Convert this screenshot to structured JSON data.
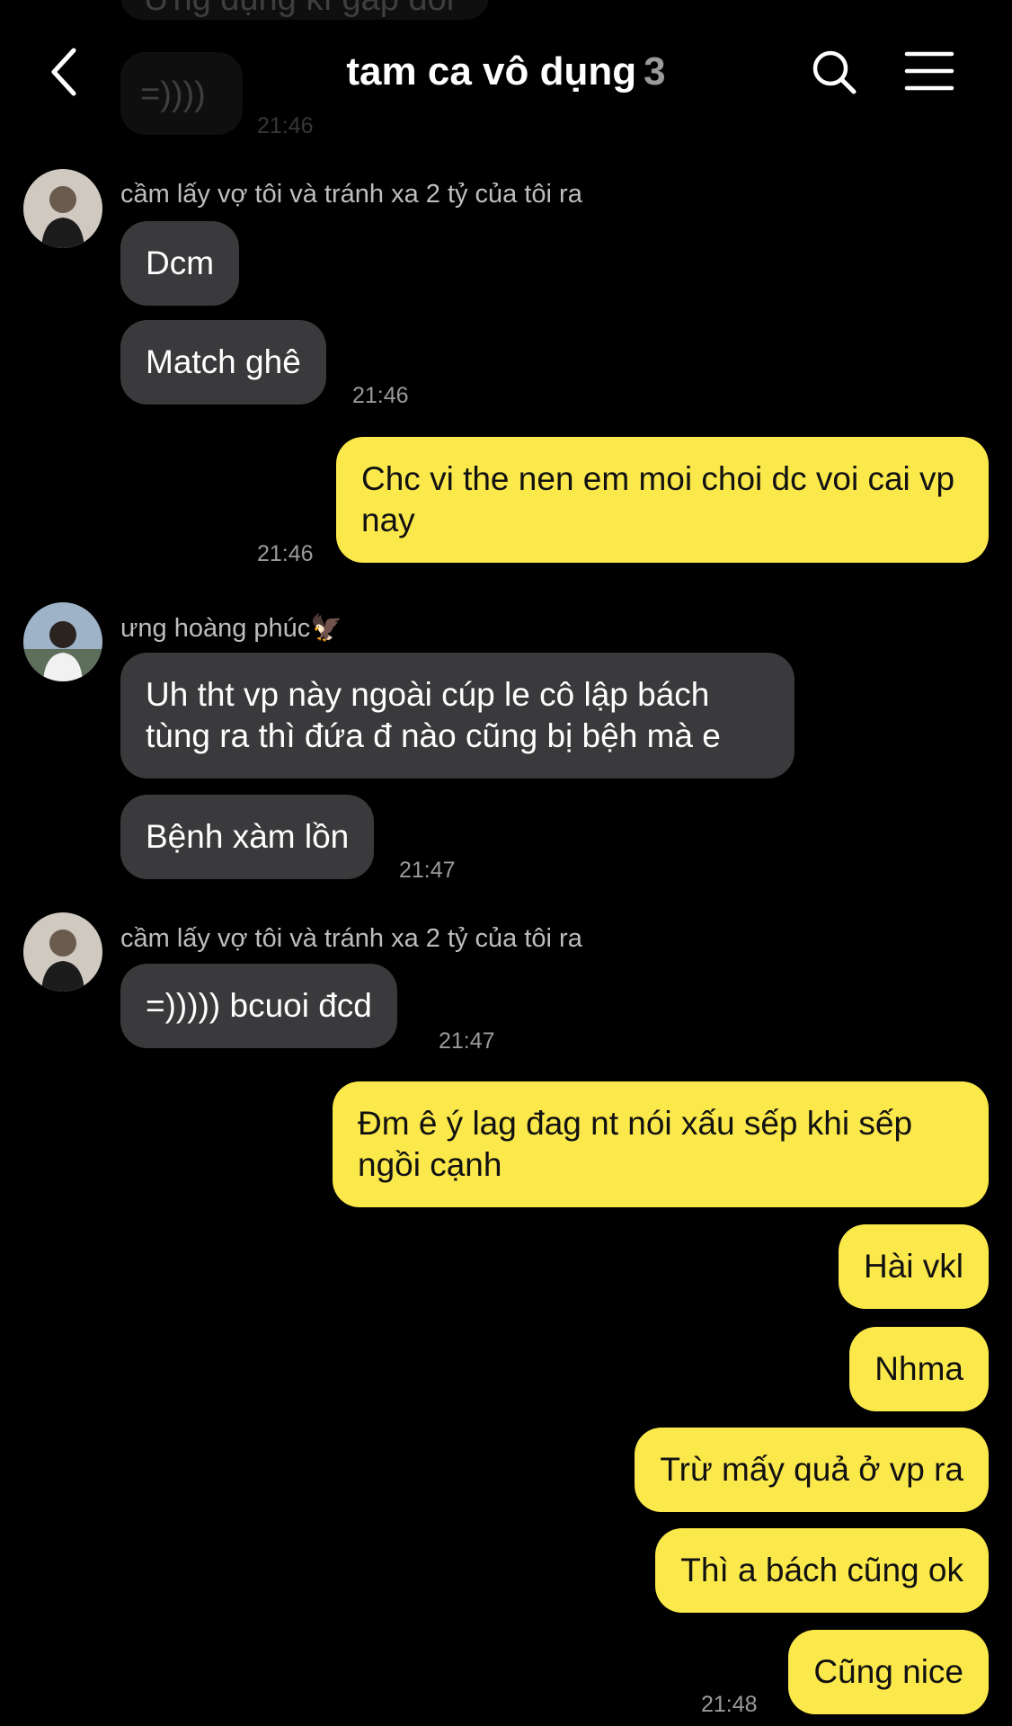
{
  "header": {
    "title": "tam ca vô dụng",
    "member_count": "3",
    "back_icon": "chevron-left-icon",
    "search_icon": "search-icon",
    "menu_icon": "hamburger-menu-icon"
  },
  "faded_top": {
    "partial_text": "Ứng dụng kí gấp đôi",
    "bubble_text": "=))))",
    "time": "21:46"
  },
  "messages": [
    {
      "sender": "cầm lấy vợ tôi và tránh xa 2 tỷ của tôi ra",
      "text": "Dcm"
    },
    {
      "text": "Match ghê",
      "time": "21:46"
    },
    {
      "text": "Chc vi the nen em moi choi dc voi cai vp nay",
      "time": "21:46"
    },
    {
      "sender": "ưng hoàng phúc🦅",
      "text": "Uh tht vp này ngoài cúp le cô lập bách tùng ra thì đứa đ nào cũng bị bệh mà e"
    },
    {
      "text": "Bệnh xàm lồn",
      "time": "21:47"
    },
    {
      "sender": "cầm lấy vợ tôi và tránh xa 2 tỷ của tôi ra",
      "text": "=))))) bcuoi đcd",
      "time": "21:47"
    },
    {
      "text": "Đm ê ý lag đag nt nói xấu sếp khi sếp ngồi cạnh"
    },
    {
      "text": "Hài vkl"
    },
    {
      "text": "Nhma"
    },
    {
      "text": "Trừ mấy quả ở vp ra"
    },
    {
      "text": "Thì a bách cũng ok"
    },
    {
      "text": "Cũng nice",
      "time": "21:48"
    }
  ],
  "colors": {
    "background": "#000000",
    "incoming_bubble": "#3a3a3c",
    "outgoing_bubble": "#fbe84b"
  }
}
